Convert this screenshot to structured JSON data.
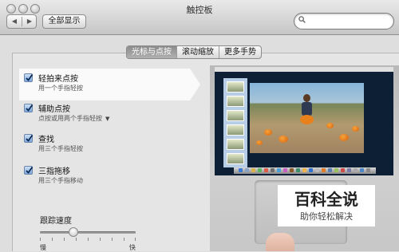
{
  "window": {
    "title": "触控板"
  },
  "toolbar": {
    "back_icon": "◀",
    "forward_icon": "▶",
    "show_all_label": "全部显示"
  },
  "search": {
    "value": "",
    "placeholder": ""
  },
  "tabs": [
    {
      "label": "光标与点按",
      "selected": true
    },
    {
      "label": "滚动缩放",
      "selected": false
    },
    {
      "label": "更多手势",
      "selected": false
    }
  ],
  "options": [
    {
      "title": "轻拍来点按",
      "subtitle": "用一个手指轻按",
      "checked": true
    },
    {
      "title": "辅助点按",
      "subtitle": "点按或用两个手指轻按",
      "checked": true,
      "has_dropdown": true
    },
    {
      "title": "查找",
      "subtitle": "用三个手指轻按",
      "checked": true
    },
    {
      "title": "三指拖移",
      "subtitle": "用三个手指移动",
      "checked": true
    }
  ],
  "tracking_speed": {
    "label": "跟踪速度",
    "min_label": "慢",
    "max_label": "快",
    "value": 0.35
  },
  "watermark": {
    "title": "百科全说",
    "subtitle": "助你轻松解决"
  },
  "colors": {
    "checkbox": "#7aa6de",
    "selected_tab": "#8c8c8c",
    "accent": "#2f6fd0"
  }
}
